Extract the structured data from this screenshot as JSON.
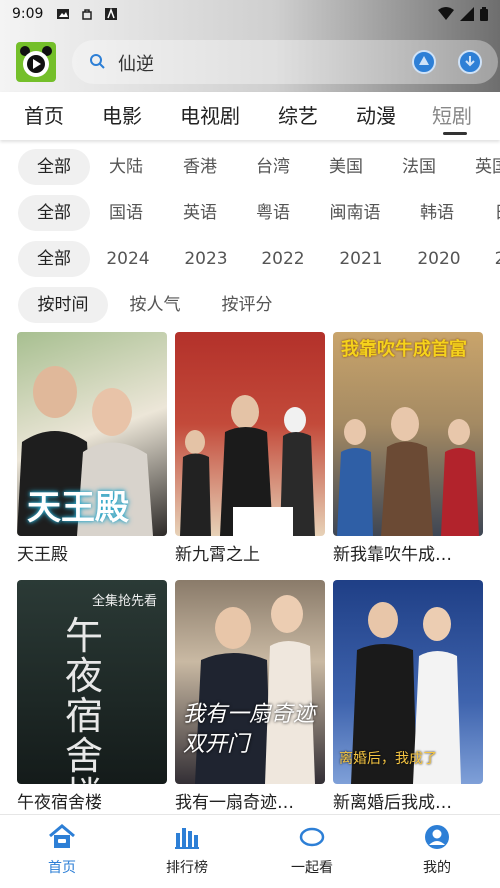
{
  "status": {
    "time": "9:09"
  },
  "search": {
    "value": "仙逆"
  },
  "tabs": [
    "首页",
    "电影",
    "电视剧",
    "综艺",
    "动漫",
    "短剧"
  ],
  "filters": {
    "region": [
      "全部",
      "大陆",
      "香港",
      "台湾",
      "美国",
      "法国",
      "英国"
    ],
    "language": [
      "全部",
      "国语",
      "英语",
      "粤语",
      "闽南语",
      "韩语",
      "日"
    ],
    "year": [
      "全部",
      "2024",
      "2023",
      "2022",
      "2021",
      "2020",
      "2"
    ],
    "sort": [
      "按时间",
      "按人气",
      "按评分"
    ]
  },
  "cards": [
    {
      "title": "天王殿",
      "poster_text": "天王殿",
      "colors": [
        "#9fb68a",
        "#e8e1d4"
      ]
    },
    {
      "title": "新九霄之上",
      "poster_text": "",
      "colors": [
        "#b3312a",
        "#d9b58a"
      ]
    },
    {
      "title": "新我靠吹牛成…",
      "poster_text": "我靠吹牛成首富",
      "colors": [
        "#c9a46b",
        "#5d6a7a"
      ]
    },
    {
      "title": "午夜宿舍楼",
      "poster_text": "午夜宿舍楼",
      "colors": [
        "#2b3a36",
        "#111615"
      ],
      "badge": "全集抢先看"
    },
    {
      "title": "我有一扇奇迹…",
      "poster_text": "我有一扇奇迹双开门",
      "colors": [
        "#c7b9a6",
        "#2d2a31"
      ]
    },
    {
      "title": "新离婚后我成…",
      "poster_text": "离婚后，我成了",
      "colors": [
        "#1f3f86",
        "#6a8fcc"
      ]
    }
  ],
  "bottom_nav": [
    "首页",
    "排行榜",
    "一起看",
    "我的"
  ],
  "colors": {
    "accent": "#2d7fd6",
    "logo": "#74bf2a"
  }
}
